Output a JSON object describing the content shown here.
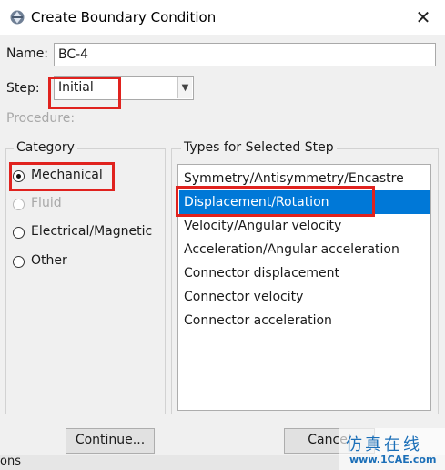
{
  "window": {
    "title": "Create Boundary Condition"
  },
  "form": {
    "name_label": "Name:",
    "name_value": "BC-4",
    "step_label": "Step:",
    "step_value": "Initial",
    "procedure_label": "Procedure:"
  },
  "category": {
    "legend": "Category",
    "options": [
      {
        "label": "Mechanical",
        "checked": true,
        "enabled": true
      },
      {
        "label": "Fluid",
        "checked": false,
        "enabled": false
      },
      {
        "label": "Electrical/Magnetic",
        "checked": false,
        "enabled": true
      },
      {
        "label": "Other",
        "checked": false,
        "enabled": true
      }
    ]
  },
  "types": {
    "legend": "Types for Selected Step",
    "items": [
      {
        "label": "Symmetry/Antisymmetry/Encastre",
        "selected": false
      },
      {
        "label": "Displacement/Rotation",
        "selected": true
      },
      {
        "label": "Velocity/Angular velocity",
        "selected": false
      },
      {
        "label": "Acceleration/Angular acceleration",
        "selected": false
      },
      {
        "label": "Connector displacement",
        "selected": false
      },
      {
        "label": "Connector velocity",
        "selected": false
      },
      {
        "label": "Connector acceleration",
        "selected": false
      }
    ]
  },
  "buttons": {
    "continue_label": "Continue...",
    "cancel_label": "Cancel"
  },
  "background": {
    "partial_text": "ons"
  },
  "watermark": {
    "text": "仿真在线",
    "url": "www.1CAE.com"
  },
  "colors": {
    "highlight_red": "#e0221e",
    "selection_blue": "#0078d7"
  }
}
